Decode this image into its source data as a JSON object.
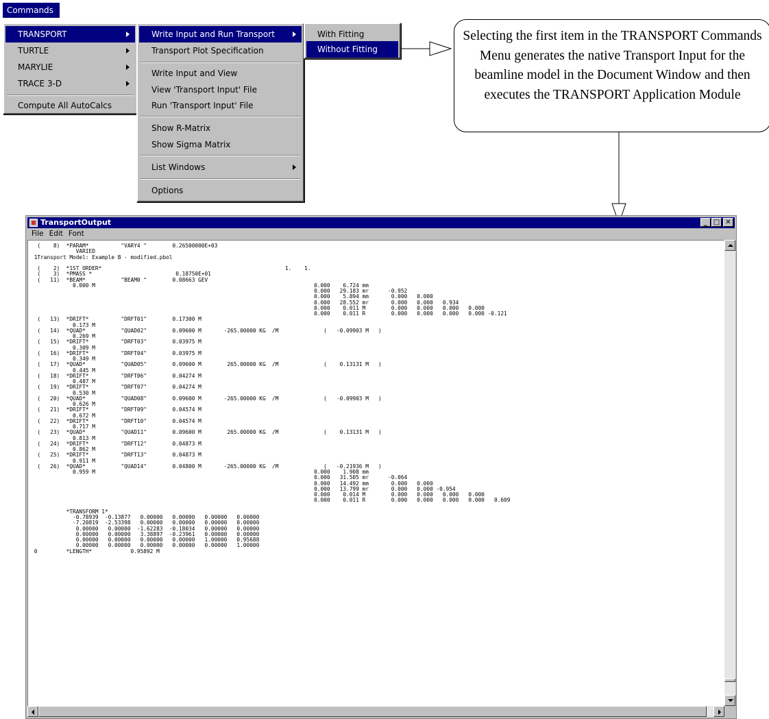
{
  "commands_menu": {
    "title": "Commands",
    "items": [
      {
        "label": "TRANSPORT",
        "has_submenu": true,
        "selected": true
      },
      {
        "label": "TURTLE",
        "has_submenu": true
      },
      {
        "label": "MARYLIE",
        "has_submenu": true
      },
      {
        "label": "TRACE 3-D",
        "has_submenu": true
      },
      {
        "label": "Compute All AutoCalcs"
      }
    ]
  },
  "transport_menu": {
    "items": [
      {
        "label": "Write Input and Run Transport",
        "has_submenu": true,
        "selected": true
      },
      {
        "label": "Transport Plot Specification"
      },
      {
        "label": "Write Input and View"
      },
      {
        "label": "View 'Transport Input' File"
      },
      {
        "label": "Run 'Transport Input' File"
      },
      {
        "label": "Show R-Matrix"
      },
      {
        "label": "Show Sigma Matrix"
      },
      {
        "label": "List Windows",
        "has_submenu": true
      },
      {
        "label": "Options"
      }
    ]
  },
  "run_menu": {
    "items": [
      {
        "label": "With Fitting"
      },
      {
        "label": "Without Fitting",
        "selected": true
      }
    ]
  },
  "callout": {
    "text": "Selecting the first item in the TRANSPORT Commands Menu generates the native Transport Input  for the beamline model in the Document Window and then executes the TRANSPORT Application Module"
  },
  "output_window": {
    "title": "TransportOutput",
    "menus": [
      "File",
      "Edit",
      "Font"
    ],
    "lines": [
      "  (    8)  *PARAM*          \"VARY4 \"        0.26500000E+03",
      "              VARIED",
      " 1Transport Model: Example B - modified.pbol",
      "",
      "  (    2)  *1ST ORDER*                                                         1.    1.",
      "  (    3)  *PMASS *                          0.18750E+01",
      "  (   11)  *BEAM*           \"BEAM0 \"        0.08663 GEV",
      "             0.000 M                                                                    0.000    6.724 mm",
      "                                                                                        0.000   29.183 mr      -0.952",
      "                                                                                        0.000    5.894 mm       0.000   0.000",
      "                                                                                        0.000   28.552 mr       0.000   0.000   0.934",
      "                                                                                        0.000    0.011 M        0.000   0.000   0.000   0.000",
      "                                                                                        0.000    0.011 R        0.000   0.000   0.000   0.000 -0.121",
      "  (   13)  *DRIFT*          \"DRFT01\"        0.17300 M",
      "             0.173 M",
      "  (   14)  *QUAD*           \"QUAD02\"        0.09600 M       -265.00000 KG  /M              (   -0.09903 M   )",
      "             0.269 M",
      "  (   15)  *DRIFT*          \"DRFT03\"        0.03975 M",
      "             0.309 M",
      "  (   16)  *DRIFT*          \"DRFT04\"        0.03975 M",
      "             0.349 M",
      "  (   17)  *QUAD*           \"QUAD05\"        0.09600 M        265.00000 KG  /M              (    0.13131 M   )",
      "             0.445 M",
      "  (   18)  *DRIFT*          \"DRFT06\"        0.04274 M",
      "             0.487 M",
      "  (   19)  *DRIFT*          \"DRFT07\"        0.04274 M",
      "             0.530 M",
      "  (   20)  *QUAD*           \"QUAD08\"        0.09600 M       -265.00000 KG  /M              (   -0.09903 M   )",
      "             0.626 M",
      "  (   21)  *DRIFT*          \"DRFT09\"        0.04574 M",
      "             0.672 M",
      "  (   22)  *DRIFT*          \"DRFT10\"        0.04574 M",
      "             0.717 M",
      "  (   23)  *QUAD*           \"QUAD11\"        0.09600 M        265.00000 KG  /M              (    0.13131 M   )",
      "             0.813 M",
      "  (   24)  *DRIFT*          \"DRFT12\"        0.04873 M",
      "             0.862 M",
      "  (   25)  *DRIFT*          \"DRFT13\"        0.04873 M",
      "             0.911 M",
      "  (   26)  *QUAD*           \"QUAD14\"        0.04800 M       -265.00000 KG  /M              (   -0.21936 M   )",
      "             0.959 M                                                                    0.000    1.908 mm",
      "                                                                                        0.000   31.505 mr      -0.064",
      "                                                                                        0.000   14.492 mm       0.000   0.000",
      "                                                                                        0.000   13.799 mr       0.000   0.000 -0.954",
      "                                                                                        0.000    0.014 M        0.000   0.000   0.000   0.000",
      "                                                                                        0.000    0.011 R        0.000   0.000   0.000   0.000   0.609",
      "",
      "           *TRANSFORM 1*",
      "             -0.78939  -0.13877   0.00000   0.00000   0.00000   0.00000",
      "             -7.20819  -2.53398   0.00000   0.00000   0.00000   0.00000",
      "              0.00000   0.00000  -1.62283  -0.18034   0.00000   0.00000",
      "              0.00000   0.00000   3.38897  -0.23961   0.00000   0.00000",
      "              0.00000   0.00000   0.00000   0.00000   1.00000   0.95688",
      "              0.00000   0.00000   0.00000   0.00000   0.00000   1.00000",
      " 0         *LENGTH*            0.95892 M"
    ]
  }
}
